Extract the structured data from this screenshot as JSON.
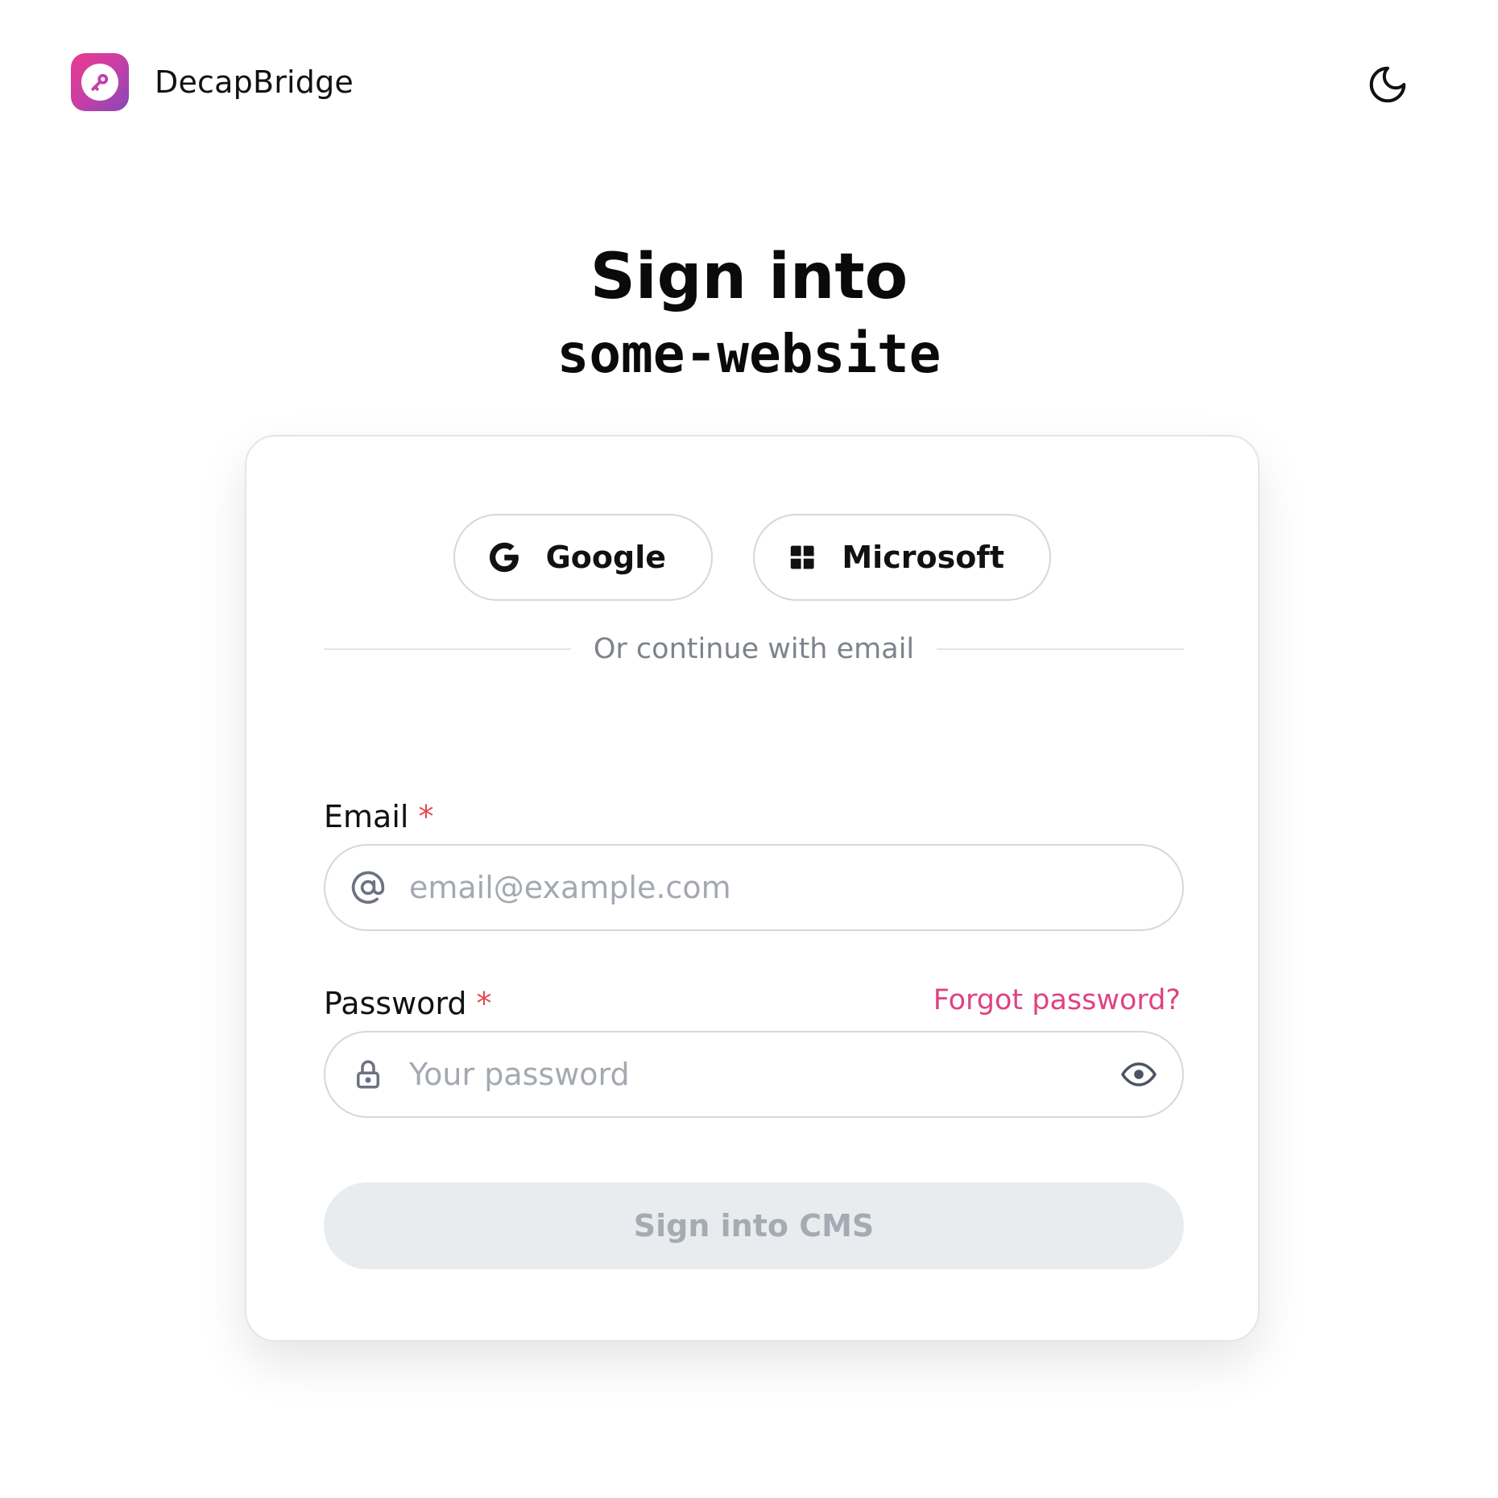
{
  "header": {
    "brand_name": "DecapBridge",
    "logo_icon": "key-icon",
    "theme_toggle_icon": "moon-icon"
  },
  "title": {
    "line1": "Sign into",
    "site_name": "some-website"
  },
  "oauth": {
    "google_label": "Google",
    "microsoft_label": "Microsoft"
  },
  "divider_text": "Or continue with email",
  "form": {
    "email_label": "Email",
    "email_required": "*",
    "email_placeholder": "email@example.com",
    "email_value": "",
    "password_label": "Password",
    "password_required": "*",
    "password_placeholder": "Your password",
    "password_value": "",
    "forgot_label": "Forgot password?",
    "submit_label": "Sign into CMS"
  },
  "colors": {
    "accent": "#e0437f",
    "required": "#e5484d",
    "logo_gradient_start": "#ec3a8f",
    "logo_gradient_end": "#8548b8",
    "submit_disabled_bg": "#e9ecef"
  }
}
